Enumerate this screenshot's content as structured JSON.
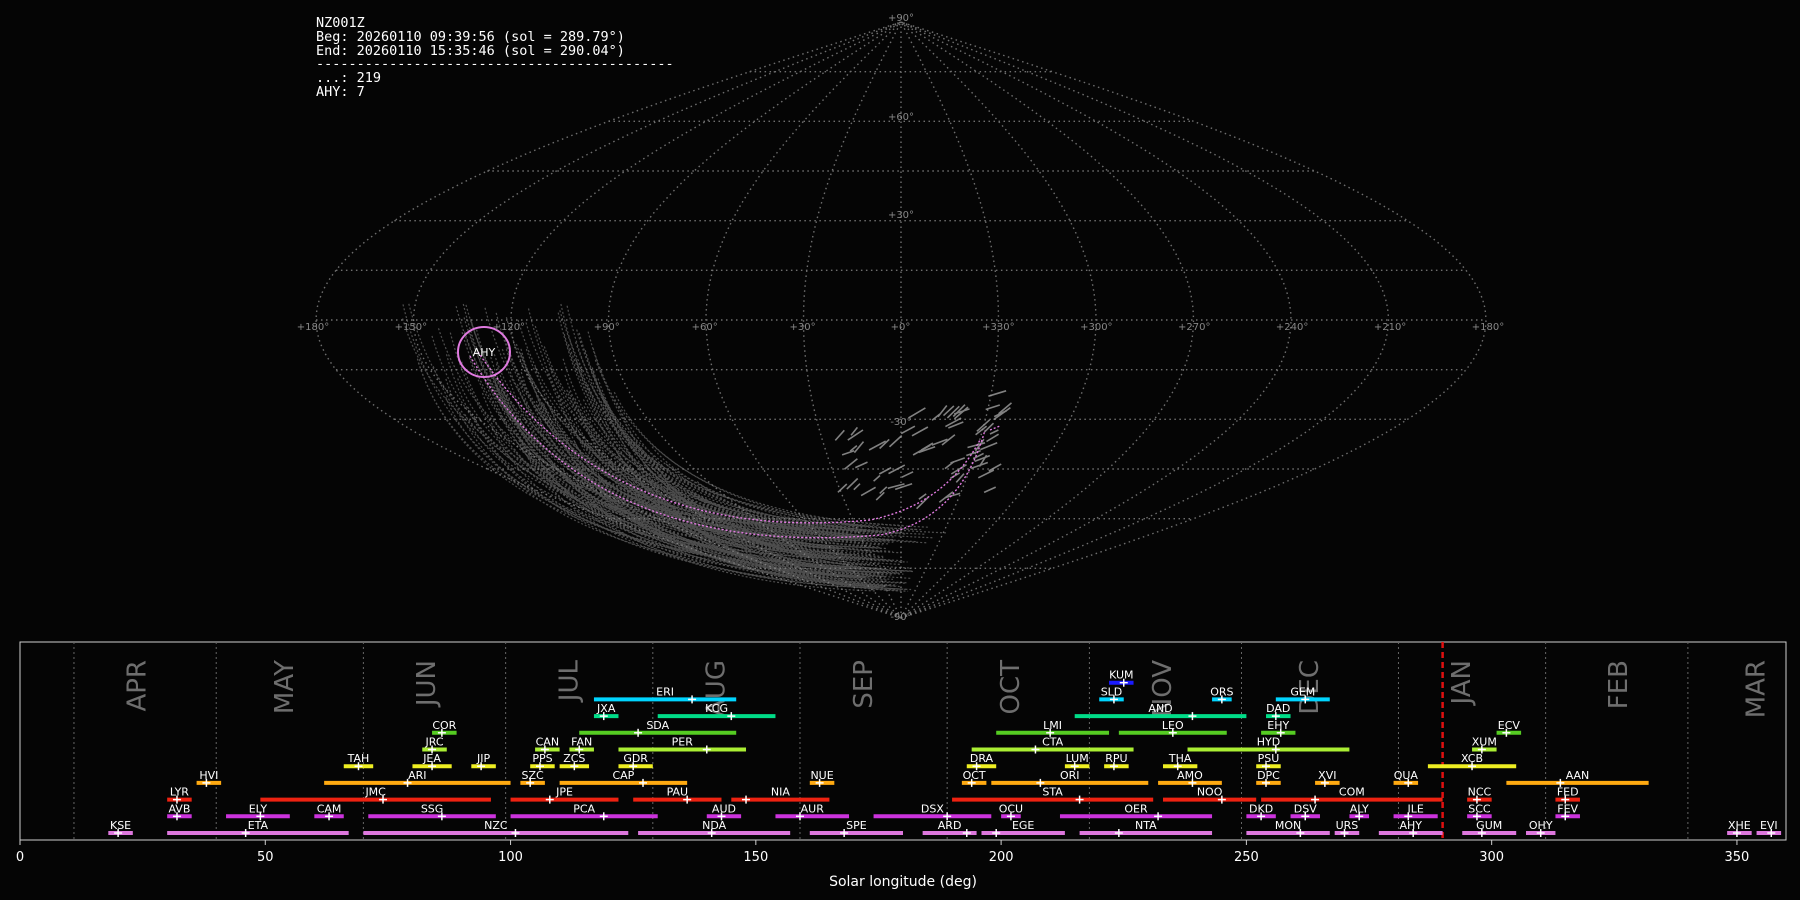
{
  "info": {
    "station": "NZ001Z",
    "beg": "Beg: 20260110 09:39:56 (sol = 289.79°)",
    "end": "End: 20260110 15:35:46 (sol = 290.04°)",
    "separator": "--------------------------------------------",
    "count_sporadic": "...: 219",
    "count_ahy": "AHY: 7"
  },
  "sky_map": {
    "lat_labels": [
      "+90°",
      "+60°",
      "+30°",
      "-30°",
      "-90°"
    ],
    "lon_labels": [
      "+180°",
      "+150°",
      "+120°",
      "+90°",
      "+60°",
      "+30°",
      "+0°",
      "+330°",
      "+300°",
      "+270°",
      "+240°",
      "+210°",
      "+180°"
    ],
    "radiant_label": "AHY",
    "grid_color": "#8a8a8a",
    "radiant_color": "#e07ae0"
  },
  "chart_data": {
    "type": "timeline",
    "xlabel": "Solar longitude (deg)",
    "xlim": [
      0,
      360
    ],
    "xticks": [
      0,
      50,
      100,
      150,
      200,
      250,
      300,
      350
    ],
    "current_sol": 290,
    "current_sol_color": "#e01010",
    "months": [
      {
        "label": "APR",
        "start": 11,
        "center": 24
      },
      {
        "label": "MAY",
        "start": 40,
        "center": 54
      },
      {
        "label": "JUN",
        "start": 70,
        "center": 83
      },
      {
        "label": "JUL",
        "start": 99,
        "center": 112
      },
      {
        "label": "AUG",
        "start": 129,
        "center": 142
      },
      {
        "label": "SEP",
        "start": 159,
        "center": 172
      },
      {
        "label": "OCT",
        "start": 189,
        "center": 202
      },
      {
        "label": "NOV",
        "start": 218,
        "center": 233
      },
      {
        "label": "DEC",
        "start": 249,
        "center": 263
      },
      {
        "label": "JAN",
        "start": 281,
        "center": 294
      },
      {
        "label": "FEB",
        "start": 311,
        "center": 326
      },
      {
        "label": "MAR",
        "start": 340,
        "center": 354
      }
    ],
    "showers": [
      {
        "code": "KUM",
        "row": 9,
        "start": 222,
        "end": 227,
        "peak": 225,
        "color": "#1a1aff"
      },
      {
        "code": "ERI",
        "row": 8,
        "start": 117,
        "end": 146,
        "peak": 137,
        "color": "#00d5ff"
      },
      {
        "code": "SLD",
        "row": 8,
        "start": 220,
        "end": 225,
        "peak": 223,
        "color": "#00d5ff"
      },
      {
        "code": "ORS",
        "row": 8,
        "start": 243,
        "end": 247,
        "peak": 245,
        "color": "#00d5ff"
      },
      {
        "code": "GEM",
        "row": 8,
        "start": 256,
        "end": 267,
        "peak": 262,
        "color": "#00d5ff"
      },
      {
        "code": "JXA",
        "row": 7,
        "start": 117,
        "end": 122,
        "peak": 119,
        "color": "#00dd88"
      },
      {
        "code": "KCG",
        "row": 7,
        "start": 130,
        "end": 154,
        "peak": 145,
        "color": "#00dd88"
      },
      {
        "code": "AND",
        "row": 7,
        "start": 215,
        "end": 250,
        "peak": 239,
        "color": "#00dd88"
      },
      {
        "code": "DAD",
        "row": 7,
        "start": 254,
        "end": 259,
        "peak": 256,
        "color": "#00dd88"
      },
      {
        "code": "COR",
        "row": 6,
        "start": 84,
        "end": 89,
        "peak": 86,
        "color": "#55cc22"
      },
      {
        "code": "SDA",
        "row": 6,
        "start": 114,
        "end": 146,
        "peak": 126,
        "color": "#55cc22"
      },
      {
        "code": "LMI",
        "row": 6,
        "start": 199,
        "end": 222,
        "peak": 210,
        "color": "#55cc22"
      },
      {
        "code": "LEO",
        "row": 6,
        "start": 224,
        "end": 246,
        "peak": 235,
        "color": "#55cc22"
      },
      {
        "code": "EHY",
        "row": 6,
        "start": 253,
        "end": 260,
        "peak": 257,
        "color": "#55cc22"
      },
      {
        "code": "ECV",
        "row": 6,
        "start": 301,
        "end": 306,
        "peak": 303,
        "color": "#55cc22"
      },
      {
        "code": "JRC",
        "row": 5,
        "start": 82,
        "end": 87,
        "peak": 84,
        "color": "#aaee33"
      },
      {
        "code": "CAN",
        "row": 5,
        "start": 105,
        "end": 110,
        "peak": 107,
        "color": "#aaee33"
      },
      {
        "code": "FAN",
        "row": 5,
        "start": 112,
        "end": 117,
        "peak": 114,
        "color": "#aaee33"
      },
      {
        "code": "PER",
        "row": 5,
        "start": 122,
        "end": 148,
        "peak": 140,
        "color": "#aaee33"
      },
      {
        "code": "CTA",
        "row": 5,
        "start": 194,
        "end": 227,
        "peak": 207,
        "color": "#aaee33"
      },
      {
        "code": "HYD",
        "row": 5,
        "start": 238,
        "end": 271,
        "peak": 256,
        "color": "#aaee33"
      },
      {
        "code": "XUM",
        "row": 5,
        "start": 296,
        "end": 301,
        "peak": 298,
        "color": "#aaee33"
      },
      {
        "code": "TAH",
        "row": 4,
        "start": 66,
        "end": 72,
        "peak": 69,
        "color": "#eeee22"
      },
      {
        "code": "JEA",
        "row": 4,
        "start": 80,
        "end": 88,
        "peak": 84,
        "color": "#eeee22"
      },
      {
        "code": "JIP",
        "row": 4,
        "start": 92,
        "end": 97,
        "peak": 94,
        "color": "#eeee22"
      },
      {
        "code": "PPS",
        "row": 4,
        "start": 104,
        "end": 109,
        "peak": 106,
        "color": "#eeee22"
      },
      {
        "code": "ZCS",
        "row": 4,
        "start": 110,
        "end": 116,
        "peak": 113,
        "color": "#eeee22"
      },
      {
        "code": "GDR",
        "row": 4,
        "start": 122,
        "end": 129,
        "peak": 125,
        "color": "#eeee22"
      },
      {
        "code": "DRA",
        "row": 4,
        "start": 193,
        "end": 199,
        "peak": 195,
        "color": "#eeee22"
      },
      {
        "code": "LUM",
        "row": 4,
        "start": 213,
        "end": 218,
        "peak": 215,
        "color": "#eeee22"
      },
      {
        "code": "RPU",
        "row": 4,
        "start": 221,
        "end": 226,
        "peak": 223,
        "color": "#eeee22"
      },
      {
        "code": "THA",
        "row": 4,
        "start": 233,
        "end": 240,
        "peak": 236,
        "color": "#eeee22"
      },
      {
        "code": "PSU",
        "row": 4,
        "start": 252,
        "end": 257,
        "peak": 254,
        "color": "#eeee22"
      },
      {
        "code": "XCB",
        "row": 4,
        "start": 287,
        "end": 305,
        "peak": 296,
        "color": "#eeee22"
      },
      {
        "code": "HVI",
        "row": 3,
        "start": 36,
        "end": 41,
        "peak": 38,
        "color": "#ffaa11"
      },
      {
        "code": "ARI",
        "row": 3,
        "start": 62,
        "end": 100,
        "peak": 79,
        "color": "#ffaa11"
      },
      {
        "code": "SZC",
        "row": 3,
        "start": 102,
        "end": 107,
        "peak": 104,
        "color": "#ffaa11"
      },
      {
        "code": "CAP",
        "row": 3,
        "start": 110,
        "end": 136,
        "peak": 127,
        "color": "#ffaa11"
      },
      {
        "code": "NUE",
        "row": 3,
        "start": 161,
        "end": 166,
        "peak": 163,
        "color": "#ffaa11"
      },
      {
        "code": "OCT",
        "row": 3,
        "start": 192,
        "end": 197,
        "peak": 194,
        "color": "#ffaa11"
      },
      {
        "code": "ORI",
        "row": 3,
        "start": 198,
        "end": 230,
        "peak": 208,
        "color": "#ffaa11"
      },
      {
        "code": "AMO",
        "row": 3,
        "start": 232,
        "end": 245,
        "peak": 239,
        "color": "#ffaa11"
      },
      {
        "code": "DPC",
        "row": 3,
        "start": 252,
        "end": 257,
        "peak": 254,
        "color": "#ffaa11"
      },
      {
        "code": "XVI",
        "row": 3,
        "start": 264,
        "end": 269,
        "peak": 266,
        "color": "#ffaa11"
      },
      {
        "code": "QUA",
        "row": 3,
        "start": 280,
        "end": 285,
        "peak": 283,
        "color": "#ffaa11"
      },
      {
        "code": "AAN",
        "row": 3,
        "start": 303,
        "end": 332,
        "peak": 314,
        "color": "#ffaa11"
      },
      {
        "code": "LYR",
        "row": 2,
        "start": 30,
        "end": 35,
        "peak": 32,
        "color": "#ee2211"
      },
      {
        "code": "JMC",
        "row": 2,
        "start": 49,
        "end": 96,
        "peak": 74,
        "color": "#ee2211"
      },
      {
        "code": "JPE",
        "row": 2,
        "start": 100,
        "end": 122,
        "peak": 108,
        "color": "#ee2211"
      },
      {
        "code": "PAU",
        "row": 2,
        "start": 125,
        "end": 143,
        "peak": 136,
        "color": "#ee2211"
      },
      {
        "code": "NIA",
        "row": 2,
        "start": 145,
        "end": 165,
        "peak": 148,
        "color": "#ee2211"
      },
      {
        "code": "STA",
        "row": 2,
        "start": 190,
        "end": 231,
        "peak": 216,
        "color": "#ee2211"
      },
      {
        "code": "NOO",
        "row": 2,
        "start": 233,
        "end": 252,
        "peak": 245,
        "color": "#ee2211"
      },
      {
        "code": "COM",
        "row": 2,
        "start": 253,
        "end": 290,
        "peak": 264,
        "color": "#ee2211"
      },
      {
        "code": "NCC",
        "row": 2,
        "start": 295,
        "end": 300,
        "peak": 297,
        "color": "#ee2211"
      },
      {
        "code": "FED",
        "row": 2,
        "start": 313,
        "end": 318,
        "peak": 315,
        "color": "#ee2211"
      },
      {
        "code": "AVB",
        "row": 1,
        "start": 30,
        "end": 35,
        "peak": 32,
        "color": "#cc33dd"
      },
      {
        "code": "ELY",
        "row": 1,
        "start": 42,
        "end": 55,
        "peak": 49,
        "color": "#cc33dd"
      },
      {
        "code": "CAM",
        "row": 1,
        "start": 60,
        "end": 66,
        "peak": 63,
        "color": "#cc33dd"
      },
      {
        "code": "SSG",
        "row": 1,
        "start": 71,
        "end": 97,
        "peak": 86,
        "color": "#cc33dd"
      },
      {
        "code": "PCA",
        "row": 1,
        "start": 100,
        "end": 130,
        "peak": 119,
        "color": "#cc33dd"
      },
      {
        "code": "AUD",
        "row": 1,
        "start": 140,
        "end": 147,
        "peak": 143,
        "color": "#cc33dd"
      },
      {
        "code": "AUR",
        "row": 1,
        "start": 154,
        "end": 169,
        "peak": 159,
        "color": "#cc33dd"
      },
      {
        "code": "DSX",
        "row": 1,
        "start": 174,
        "end": 198,
        "peak": 189,
        "color": "#cc33dd"
      },
      {
        "code": "OCU",
        "row": 1,
        "start": 200,
        "end": 204,
        "peak": 202,
        "color": "#cc33dd"
      },
      {
        "code": "OER",
        "row": 1,
        "start": 212,
        "end": 243,
        "peak": 232,
        "color": "#cc33dd"
      },
      {
        "code": "DKD",
        "row": 1,
        "start": 250,
        "end": 256,
        "peak": 253,
        "color": "#cc33dd"
      },
      {
        "code": "DSV",
        "row": 1,
        "start": 259,
        "end": 265,
        "peak": 262,
        "color": "#cc33dd"
      },
      {
        "code": "ALY",
        "row": 1,
        "start": 271,
        "end": 275,
        "peak": 273,
        "color": "#cc33dd"
      },
      {
        "code": "ILE",
        "row": 1,
        "start": 280,
        "end": 289,
        "peak": 283,
        "color": "#cc33dd"
      },
      {
        "code": "SCC",
        "row": 1,
        "start": 295,
        "end": 300,
        "peak": 297,
        "color": "#cc33dd"
      },
      {
        "code": "FEV",
        "row": 1,
        "start": 313,
        "end": 318,
        "peak": 315,
        "color": "#cc33dd"
      },
      {
        "code": "KSE",
        "row": 0,
        "start": 18,
        "end": 23,
        "peak": 20,
        "color": "#dd77dd"
      },
      {
        "code": "ETA",
        "row": 0,
        "start": 30,
        "end": 67,
        "peak": 46,
        "color": "#dd77dd"
      },
      {
        "code": "NZC",
        "row": 0,
        "start": 70,
        "end": 124,
        "peak": 101,
        "color": "#dd77dd"
      },
      {
        "code": "NDA",
        "row": 0,
        "start": 126,
        "end": 157,
        "peak": 141,
        "color": "#dd77dd"
      },
      {
        "code": "SPE",
        "row": 0,
        "start": 161,
        "end": 180,
        "peak": 168,
        "color": "#dd77dd"
      },
      {
        "code": "ARD",
        "row": 0,
        "start": 184,
        "end": 195,
        "peak": 193,
        "color": "#dd77dd"
      },
      {
        "code": "EGE",
        "row": 0,
        "start": 196,
        "end": 213,
        "peak": 199,
        "color": "#dd77dd"
      },
      {
        "code": "NTA",
        "row": 0,
        "start": 216,
        "end": 243,
        "peak": 224,
        "color": "#dd77dd"
      },
      {
        "code": "MON",
        "row": 0,
        "start": 250,
        "end": 267,
        "peak": 261,
        "color": "#dd77dd"
      },
      {
        "code": "URS",
        "row": 0,
        "start": 268,
        "end": 273,
        "peak": 270,
        "color": "#dd77dd"
      },
      {
        "code": "AHY",
        "row": 0,
        "start": 277,
        "end": 290,
        "peak": 284,
        "color": "#dd77dd"
      },
      {
        "code": "GUM",
        "row": 0,
        "start": 294,
        "end": 305,
        "peak": 298,
        "color": "#dd77dd"
      },
      {
        "code": "OHY",
        "row": 0,
        "start": 307,
        "end": 313,
        "peak": 310,
        "color": "#dd77dd"
      },
      {
        "code": "XHE",
        "row": 0,
        "start": 348,
        "end": 353,
        "peak": 350,
        "color": "#dd77dd"
      },
      {
        "code": "EVI",
        "row": 0,
        "start": 354,
        "end": 359,
        "peak": 357,
        "color": "#dd77dd"
      }
    ]
  }
}
